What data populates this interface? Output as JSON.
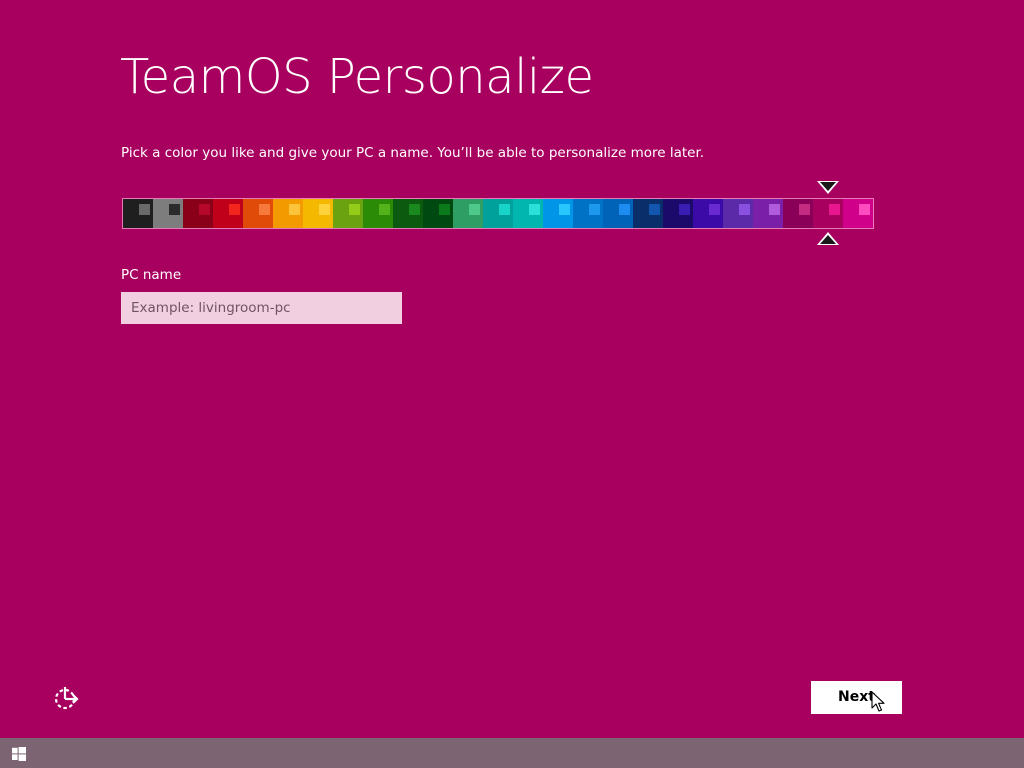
{
  "window": {
    "title": "TeamOS Personalize",
    "instructions": "Pick a color you like and give your PC a name. You’ll be able to personalize more later."
  },
  "accent_color": "#a8005f",
  "color_picker": {
    "selected_index": 23,
    "swatches": [
      {
        "bg": "#1f1f1f",
        "inner": "#6a6a6a"
      },
      {
        "bg": "#7d7d7d",
        "inner": "#2b2b2b"
      },
      {
        "bg": "#8a0018",
        "inner": "#b6082a"
      },
      {
        "bg": "#c0001a",
        "inner": "#f2261f"
      },
      {
        "bg": "#e04b0a",
        "inner": "#f77a3c"
      },
      {
        "bg": "#f29a00",
        "inner": "#fbc43a"
      },
      {
        "bg": "#f5b800",
        "inner": "#ffd23c"
      },
      {
        "bg": "#6aa30f",
        "inner": "#95cc1a"
      },
      {
        "bg": "#2b8a06",
        "inner": "#54b21a"
      },
      {
        "bg": "#0b5a0f",
        "inner": "#1b8a1e"
      },
      {
        "bg": "#004a12",
        "inner": "#0a7a1a"
      },
      {
        "bg": "#2e9e64",
        "inner": "#4ec98a"
      },
      {
        "bg": "#00a19a",
        "inner": "#18d4c8"
      },
      {
        "bg": "#00b6ae",
        "inner": "#2ae0d8"
      },
      {
        "bg": "#0095e6",
        "inner": "#28c6ff"
      },
      {
        "bg": "#0072c6",
        "inner": "#1e98ec"
      },
      {
        "bg": "#0063b8",
        "inner": "#1c8cf0"
      },
      {
        "bg": "#0a2e6a",
        "inner": "#1256b0"
      },
      {
        "bg": "#1c0a6a",
        "inner": "#3a1eb4"
      },
      {
        "bg": "#3c0aa6",
        "inner": "#6a2ad2"
      },
      {
        "bg": "#5a2aa8",
        "inner": "#8a50e0"
      },
      {
        "bg": "#7a1fa8",
        "inner": "#b05adc"
      },
      {
        "bg": "#8a0058",
        "inner": "#c42c82"
      },
      {
        "bg": "#a8005f",
        "inner": "#e8178f"
      },
      {
        "bg": "#d0008a",
        "inner": "#ff4bc0"
      }
    ]
  },
  "pc_name": {
    "label": "PC name",
    "placeholder": "Example: livingroom-pc",
    "value": ""
  },
  "ease_of_access": {
    "icon": "ease-of-access-icon"
  },
  "buttons": {
    "next_label": "Next"
  },
  "taskbar": {
    "start_icon": "windows-start-icon",
    "background": "#7d6473"
  }
}
